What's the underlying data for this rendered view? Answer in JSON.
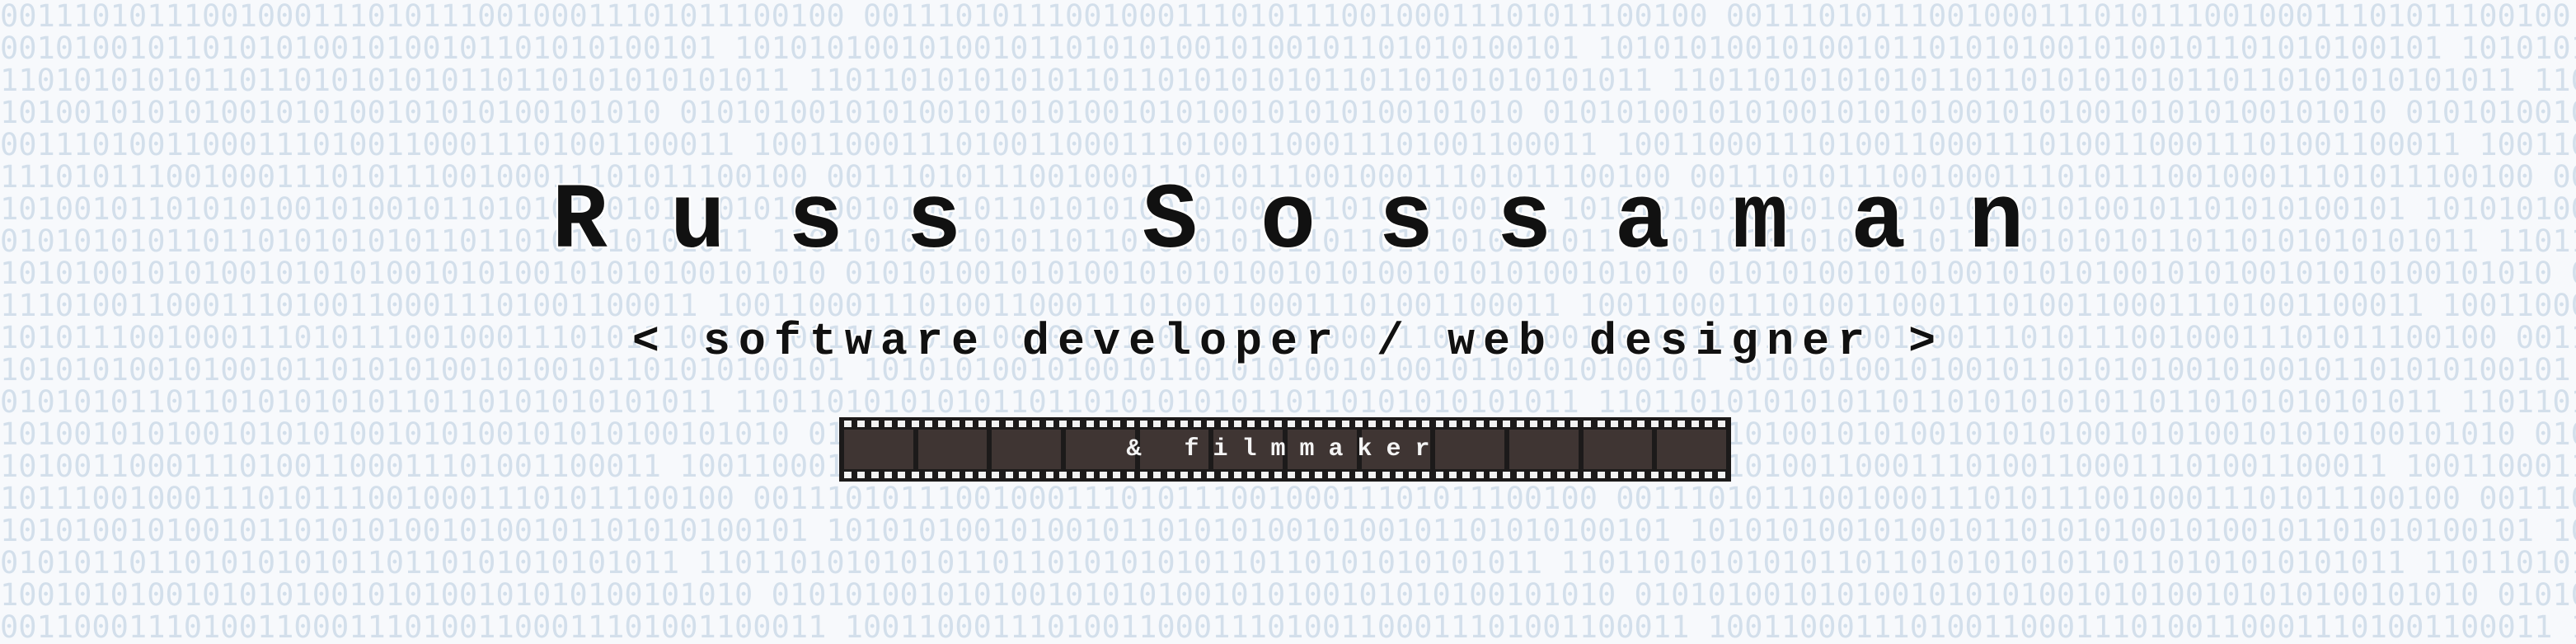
{
  "header": {
    "name": "Russ Sossaman",
    "tagline": "< software developer / web designer >",
    "film_label": "& filmmaker"
  },
  "background": {
    "pattern": "binary-digits",
    "digit_color": "#d3dfeb",
    "base_color": "#f7f9fc"
  },
  "filmstrip": {
    "film_color": "#1c1a1a",
    "frame_color": "#3f3533",
    "sprocket_color": "#f2f2f2"
  }
}
